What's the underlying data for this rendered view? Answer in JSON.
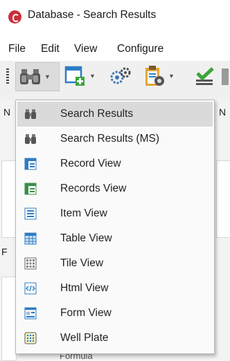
{
  "window": {
    "title": "Database - Search Results"
  },
  "menubar": {
    "items": [
      "File",
      "Edit",
      "View",
      "Configure"
    ]
  },
  "dropdown": {
    "items": [
      {
        "label": "Search Results",
        "icon": "binoculars-icon",
        "selected": true
      },
      {
        "label": "Search Results (MS)",
        "icon": "binoculars-ms-icon",
        "selected": false
      },
      {
        "label": "Record View",
        "icon": "record-view-icon",
        "selected": false
      },
      {
        "label": "Records View",
        "icon": "records-view-icon",
        "selected": false
      },
      {
        "label": "Item View",
        "icon": "item-view-icon",
        "selected": false
      },
      {
        "label": "Table View",
        "icon": "table-view-icon",
        "selected": false
      },
      {
        "label": "Tile View",
        "icon": "tile-view-icon",
        "selected": false
      },
      {
        "label": "Html View",
        "icon": "html-view-icon",
        "selected": false
      },
      {
        "label": "Form View",
        "icon": "form-view-icon",
        "selected": false
      },
      {
        "label": "Well Plate",
        "icon": "well-plate-icon",
        "selected": false
      }
    ]
  },
  "background": {
    "letters": [
      "N",
      "N",
      "F"
    ],
    "field_text": "Formula"
  },
  "colors": {
    "accent": "#2e7cc4",
    "logo": "#c8313a",
    "green": "#3aa53a"
  }
}
